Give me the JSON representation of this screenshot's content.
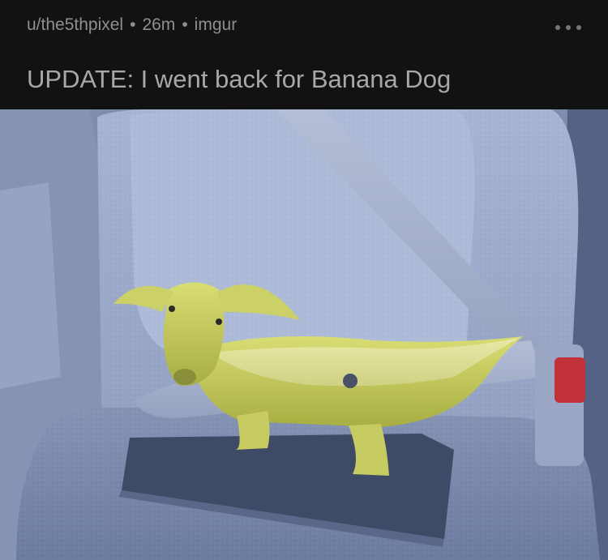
{
  "post": {
    "author": "u/the5thpixel",
    "time_ago": "26m",
    "source": "imgur",
    "separator": "•",
    "title": "UPDATE: I went back for Banana Dog"
  },
  "media": {
    "alt": "banana peel dachshund figurine buckled into car seat"
  },
  "colors": {
    "background": "#121212",
    "meta_text": "#8f8f8f",
    "title_text": "#a8a8a8"
  }
}
